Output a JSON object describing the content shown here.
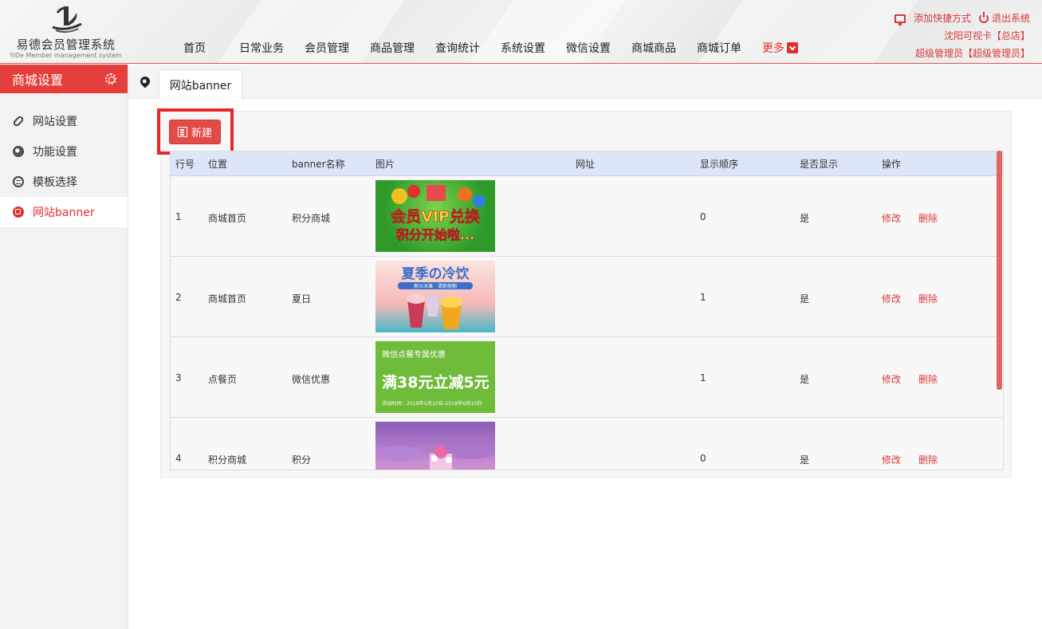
{
  "brand": {
    "name_cn": "易德会员管理系统",
    "name_en": "YiDe Member management system"
  },
  "nav": {
    "items": [
      "首页",
      "日常业务",
      "会员管理",
      "商品管理",
      "查询统计",
      "系统设置",
      "微信设置",
      "商城商品",
      "商城订单"
    ],
    "more": "更多"
  },
  "top_right": {
    "add_shortcut": "添加快捷方式",
    "logout": "退出系统",
    "store": "沈阳可视卡【总店】",
    "user": "超级管理员【超级管理员】"
  },
  "sidebar": {
    "title": "商城设置",
    "items": [
      {
        "label": "网站设置",
        "icon": "link-icon"
      },
      {
        "label": "功能设置",
        "icon": "globe-icon"
      },
      {
        "label": "模板选择",
        "icon": "template-icon"
      },
      {
        "label": "网站banner",
        "icon": "banner-icon",
        "active": true
      }
    ]
  },
  "tab": {
    "label": "网站banner"
  },
  "toolbar": {
    "new_label": "新建"
  },
  "table": {
    "headers": [
      "行号",
      "位置",
      "banner名称",
      "图片",
      "网址",
      "显示顺序",
      "是否显示",
      "操作"
    ],
    "edit_label": "修改",
    "delete_label": "删除",
    "rows": [
      {
        "no": "1",
        "position": "商城首页",
        "name": "积分商城",
        "url": "",
        "order": "0",
        "visible": "是",
        "img_text": {
          "line1": "会员VIP兑换",
          "line2": "积分开始啦..."
        }
      },
      {
        "no": "2",
        "position": "商城首页",
        "name": "夏日",
        "url": "",
        "order": "1",
        "visible": "是",
        "img_text": {
          "line1": "夏季の冷饮",
          "line2": "新沙冰果 · 清新假期"
        }
      },
      {
        "no": "3",
        "position": "点餐页",
        "name": "微信优惠",
        "url": "",
        "order": "1",
        "visible": "是",
        "img_text": {
          "line1": "微信点餐专属优惠",
          "line2": "满38元立减5元",
          "line3": "活动时间：2018年5月10日-2018年6月10日"
        }
      },
      {
        "no": "4",
        "position": "积分商城",
        "name": "积分",
        "url": "",
        "order": "0",
        "visible": "是",
        "img_text": {
          "line1": ""
        }
      }
    ]
  },
  "colors": {
    "accent": "#e53f3d",
    "header_row": "#dde6f8"
  }
}
